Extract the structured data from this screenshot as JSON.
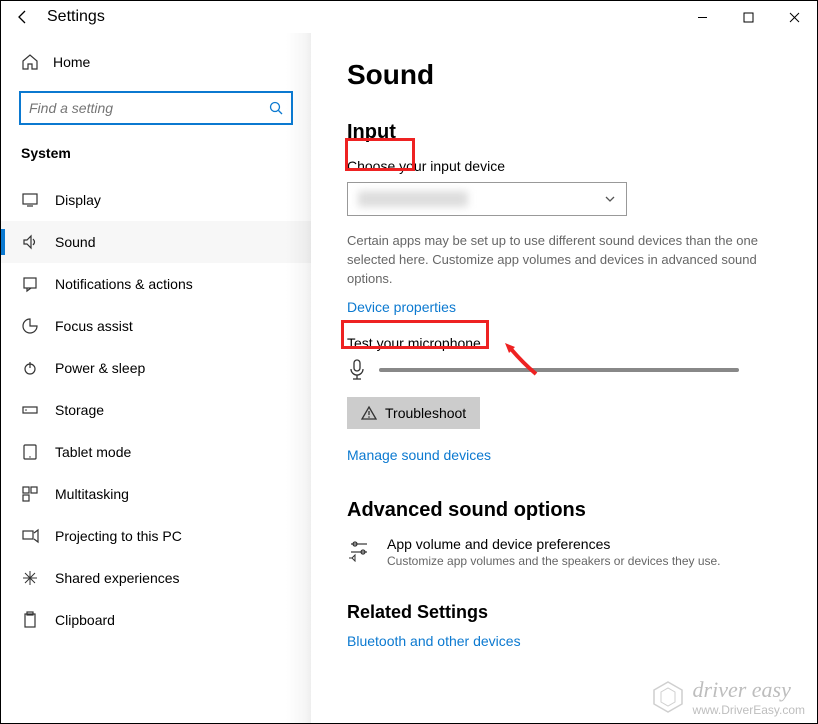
{
  "titlebar": {
    "title": "Settings"
  },
  "sidebar": {
    "home": "Home",
    "search_placeholder": "Find a setting",
    "section": "System",
    "items": [
      {
        "label": "Display"
      },
      {
        "label": "Sound"
      },
      {
        "label": "Notifications & actions"
      },
      {
        "label": "Focus assist"
      },
      {
        "label": "Power & sleep"
      },
      {
        "label": "Storage"
      },
      {
        "label": "Tablet mode"
      },
      {
        "label": "Multitasking"
      },
      {
        "label": "Projecting to this PC"
      },
      {
        "label": "Shared experiences"
      },
      {
        "label": "Clipboard"
      }
    ]
  },
  "main": {
    "heading": "Sound",
    "input_section": "Input",
    "choose_label": "Choose your input device",
    "desc": "Certain apps may be set up to use different sound devices than the one selected here. Customize app volumes and devices in advanced sound options.",
    "device_properties": "Device properties",
    "test_label": "Test your microphone",
    "troubleshoot": "Troubleshoot",
    "manage": "Manage sound devices",
    "advanced_heading": "Advanced sound options",
    "adv_title": "App volume and device preferences",
    "adv_sub": "Customize app volumes and the speakers or devices they use.",
    "related_heading": "Related Settings",
    "related_link": "Bluetooth and other devices"
  },
  "watermark": {
    "brand": "driver easy",
    "url": "www.DriverEasy.com"
  }
}
